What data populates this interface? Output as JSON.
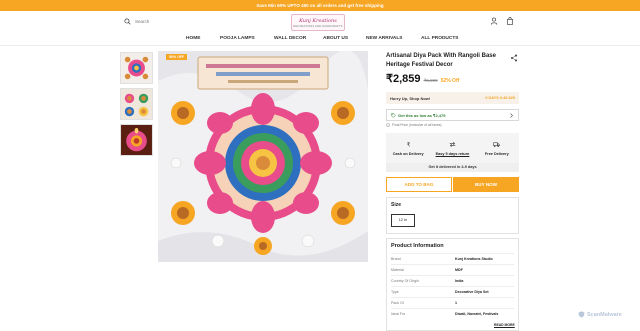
{
  "promo": "Save Min 50% UPTO 450 on all orders and get free shipping",
  "header": {
    "search_placeholder": "Search",
    "logo_text": "Kunj Kreations",
    "logo_tagline": "DECORATIONS AND HANDICRAFTS"
  },
  "nav": [
    {
      "label": "HOME",
      "name": "nav-home"
    },
    {
      "label": "POOJA LAMPS",
      "name": "nav-pooja-lamps"
    },
    {
      "label": "WALL DECOR",
      "name": "nav-wall-decor"
    },
    {
      "label": "ABOUT US",
      "name": "nav-about-us"
    },
    {
      "label": "NEW ARRIVALS",
      "name": "nav-new-arrivals"
    },
    {
      "label": "ALL PRODUCTS",
      "name": "nav-all-products"
    }
  ],
  "gallery": {
    "badge": "50% OFF"
  },
  "product": {
    "title": "Artisanal Diya Pack With Rangoli Base Heritage Festival Decor",
    "price": "₹2,859",
    "mrp": "₹5,999",
    "discount": "52% Off",
    "hurry": "Hurry Up, Shop Now!",
    "timer": "0 DAYS 0:46:825",
    "offer": "Get this as low as ₹2,479",
    "tax_note": "Final Price (Inclusive of all taxes)",
    "features": [
      {
        "label": "Cash on Delivery",
        "icon": "rupee-icon"
      },
      {
        "label": "Easy 5 days return",
        "icon": "return-icon"
      },
      {
        "label": "Free Delivery",
        "icon": "truck-icon"
      }
    ],
    "delivery_note": "Get it delivered in 4-9 days",
    "add_to_bag": "ADD TO BAG",
    "buy_now": "BUY NOW"
  },
  "size": {
    "title": "Size",
    "selected": "12 In"
  },
  "info": {
    "title": "Product Information",
    "rows": [
      {
        "key": "Brand",
        "value": "Kunj Kreations Studio"
      },
      {
        "key": "Material",
        "value": "MDF"
      },
      {
        "key": "Country Of Origin",
        "value": "India"
      },
      {
        "key": "Type",
        "value": "Decorative Diya Set"
      },
      {
        "key": "Pack Of",
        "value": "1"
      },
      {
        "key": "Ideal For",
        "value": "Diwali, Navratri, Festivals"
      }
    ],
    "read_more": "READ MORE"
  },
  "watermark": "ScanMalware",
  "colors": {
    "accent": "#f6a623",
    "offer_green": "#2e7d32",
    "brand_pink": "#b0306a"
  }
}
